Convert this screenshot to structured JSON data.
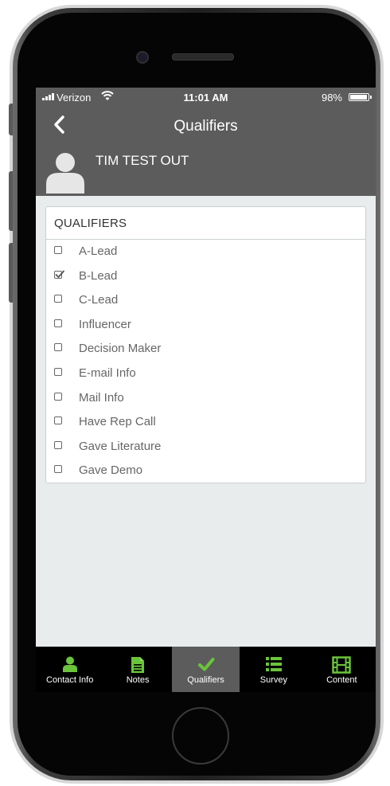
{
  "status_bar": {
    "carrier": "Verizon",
    "time": "11:01 AM",
    "battery": "98%"
  },
  "nav": {
    "title": "Qualifiers"
  },
  "contact": {
    "name": "TIM TEST OUT"
  },
  "qualifiers": {
    "header": "QUALIFIERS",
    "items": [
      {
        "label": "A-Lead",
        "checked": false
      },
      {
        "label": "B-Lead",
        "checked": true
      },
      {
        "label": "C-Lead",
        "checked": false
      },
      {
        "label": "Influencer",
        "checked": false
      },
      {
        "label": "Decision Maker",
        "checked": false
      },
      {
        "label": "E-mail Info",
        "checked": false
      },
      {
        "label": "Mail Info",
        "checked": false
      },
      {
        "label": "Have Rep Call",
        "checked": false
      },
      {
        "label": "Gave Literature",
        "checked": false
      },
      {
        "label": "Gave Demo",
        "checked": false
      }
    ]
  },
  "tabs": [
    {
      "label": "Contact Info",
      "icon": "person-icon",
      "active": false
    },
    {
      "label": "Notes",
      "icon": "document-icon",
      "active": false
    },
    {
      "label": "Qualifiers",
      "icon": "checkmark-icon",
      "active": true
    },
    {
      "label": "Survey",
      "icon": "list-icon",
      "active": false
    },
    {
      "label": "Content",
      "icon": "film-icon",
      "active": false
    }
  ],
  "colors": {
    "header_bg": "#5c5c5c",
    "tab_bar_bg": "#000000",
    "active_tab_bg": "#5c5c5c",
    "accent_green": "#6ac43b",
    "screen_bg": "#e8ecec"
  }
}
